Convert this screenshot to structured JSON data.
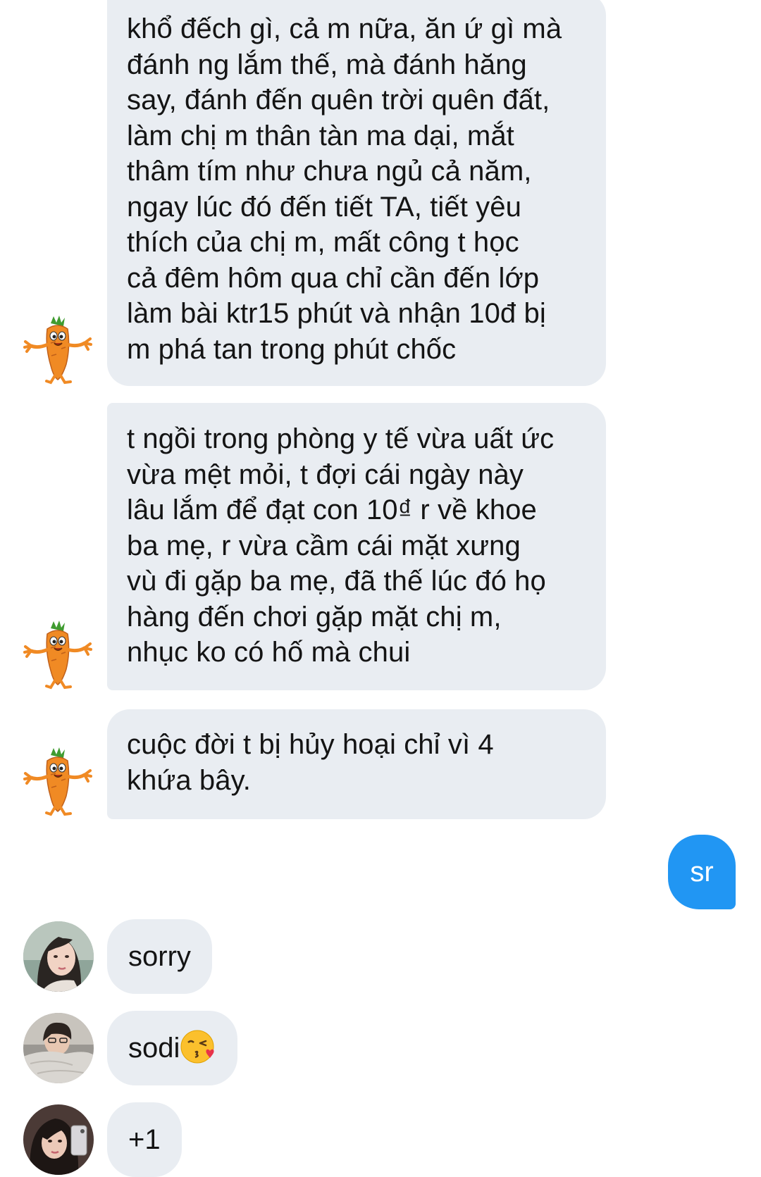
{
  "messages": [
    {
      "sender": "carrot",
      "text": "khổ đếch gì, cả m nữa, ăn ứ gì mà\nđánh ng lắm thế, mà đánh hăng\nsay, đánh đến quên trời quên đất,\nlàm chị m thân tàn ma dại, mắt\nthâm tím như chưa ngủ cả năm,\nngay lúc đó đến tiết TA, tiết yêu\nthích của chị m, mất công t học\ncả đêm hôm qua chỉ cần đến lớp\nlàm bài ktr15 phút và nhận 10đ bị\nm phá tan trong phút chốc"
    },
    {
      "sender": "carrot",
      "text": "t ngồi trong phòng y tế vừa uất ức\nvừa mệt mỏi, t đợi cái ngày này\nlâu lắm để đạt con 10₫ r về khoe\nba mẹ, r vừa cầm cái mặt xưng\nvù đi gặp ba mẹ, đã thế lúc đó họ\nhàng đến chơi gặp mặt chị m,\nnhục ko có hố mà chui"
    },
    {
      "sender": "carrot",
      "text": "cuộc đời t bị hủy hoại chỉ vì 4\nkhứa bây."
    },
    {
      "sender": "me",
      "text": "sr"
    },
    {
      "sender": "user1",
      "text": "sorry"
    },
    {
      "sender": "user2",
      "text": "sodi",
      "emoji": "face-blowing-kiss-emoji"
    },
    {
      "sender": "user3",
      "text": "+1"
    }
  ],
  "colors": {
    "incoming_bubble": "#e9edf2",
    "outgoing_bubble": "#2196f3",
    "carrot": "#f08a24",
    "carrot_leaves": "#3f9b2f"
  }
}
